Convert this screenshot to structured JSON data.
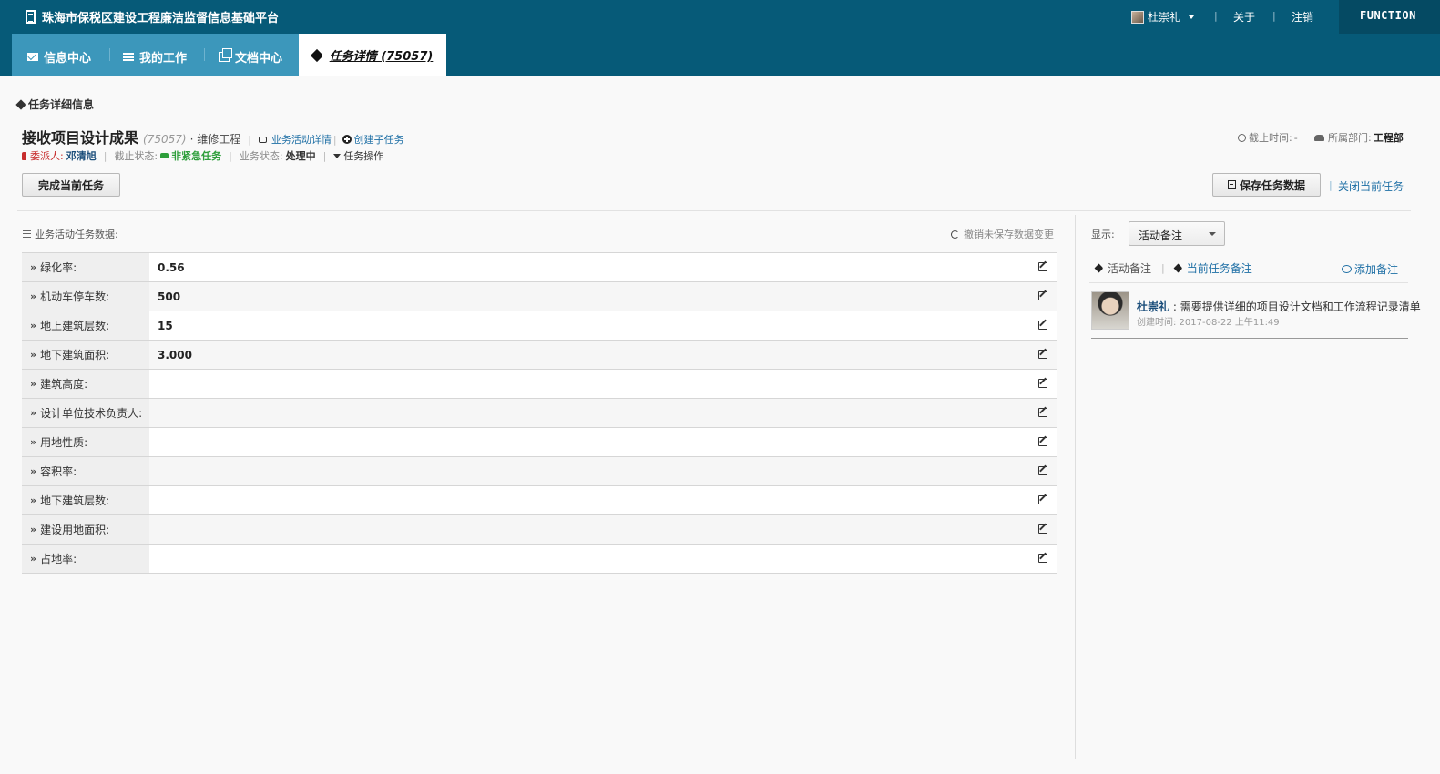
{
  "header": {
    "app_title": "珠海市保税区建设工程廉洁监督信息基础平台",
    "user_name": "杜崇礼",
    "about_label": "关于",
    "logout_label": "注销",
    "brand_mark": "FUNCTION"
  },
  "nav": {
    "tabs": [
      {
        "label": "信息中心",
        "icon": "mail-icon"
      },
      {
        "label": "我的工作",
        "icon": "list-icon"
      },
      {
        "label": "文档中心",
        "icon": "docs-icon"
      }
    ],
    "active_tab": "任务详情 (75057)"
  },
  "section": {
    "title": "任务详细信息"
  },
  "task": {
    "title": "接收项目设计成果",
    "id": "(75057)",
    "type": "· 维修工程",
    "activity_link": "业务活动详情",
    "create_subtask": "创建子任务",
    "assigner_label": "委派人:",
    "assigner": "邓清旭",
    "deadline_state_label": "截止状态:",
    "deadline_state": "非紧急任务",
    "biz_state_label": "业务状态:",
    "biz_state": "处理中",
    "task_ops": "任务操作",
    "deadline_label": "截止时间:",
    "deadline_value": "-",
    "department_label": "所属部门:",
    "department": "工程部"
  },
  "actions": {
    "complete": "完成当前任务",
    "save": "保存任务数据",
    "close": "关闭当前任务"
  },
  "data_panel": {
    "title": "业务活动任务数据:",
    "undo": "撤销未保存数据变更",
    "rows": [
      {
        "label": "绿化率:",
        "value": "0.56"
      },
      {
        "label": "机动车停车数:",
        "value": "500"
      },
      {
        "label": "地上建筑层数:",
        "value": "15"
      },
      {
        "label": "地下建筑面积:",
        "value": "3.000"
      },
      {
        "label": "建筑高度:",
        "value": ""
      },
      {
        "label": "设计单位技术负责人:",
        "value": ""
      },
      {
        "label": "用地性质:",
        "value": ""
      },
      {
        "label": "容积率:",
        "value": ""
      },
      {
        "label": "地下建筑层数:",
        "value": ""
      },
      {
        "label": "建设用地面积:",
        "value": ""
      },
      {
        "label": "占地率:",
        "value": ""
      }
    ]
  },
  "notes_panel": {
    "show_label": "显示:",
    "select_value": "活动备注",
    "tab_activity": "活动备注",
    "tab_current": "当前任务备注",
    "add_note": "添加备注",
    "note": {
      "author": "杜崇礼",
      "text": "需要提供详细的项目设计文档和工作流程记录清单",
      "time": "创建时间: 2017-08-22 上午11:49"
    }
  }
}
